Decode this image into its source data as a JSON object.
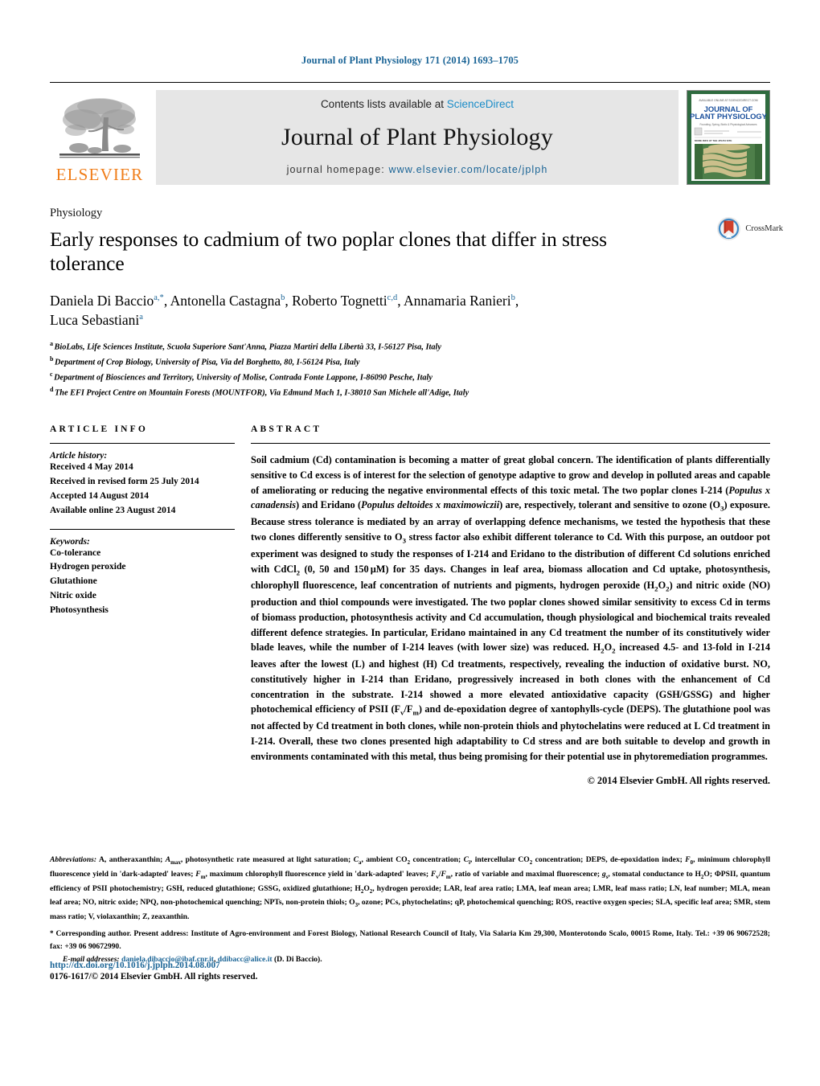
{
  "running_head": "Journal of Plant Physiology 171 (2014) 1693–1705",
  "masthead": {
    "publisher_logo_text": "ELSEVIER",
    "contents_prefix": "Contents lists available at ",
    "contents_link": "ScienceDirect",
    "journal_name": "Journal of Plant Physiology",
    "homepage_prefix": "journal homepage: ",
    "homepage_url": "www.elsevier.com/locate/jplph",
    "cover_title_line1": "JOURNAL OF",
    "cover_title_line2": "PLANT PHYSIOLOGY"
  },
  "article": {
    "section_kicker": "Physiology",
    "title": "Early responses to cadmium of two poplar clones that differ in stress tolerance",
    "crossmark_label": "CrossMark",
    "authors": [
      {
        "name": "Daniela Di Baccio",
        "marks": "a,*"
      },
      {
        "name": "Antonella Castagna",
        "marks": "b"
      },
      {
        "name": "Roberto Tognetti",
        "marks": "c,d"
      },
      {
        "name": "Annamaria Ranieri",
        "marks": "b"
      },
      {
        "name": "Luca Sebastiani",
        "marks": "a"
      }
    ],
    "affiliations": [
      {
        "mark": "a",
        "text": "BioLabs, Life Sciences Institute, Scuola Superiore Sant'Anna, Piazza Martiri della Libertà 33, I-56127 Pisa, Italy"
      },
      {
        "mark": "b",
        "text": "Department of Crop Biology, University of Pisa, Via del Borghetto, 80, I-56124 Pisa, Italy"
      },
      {
        "mark": "c",
        "text": "Department of Biosciences and Territory, University of Molise, Contrada Fonte Lappone, I-86090 Pesche, Italy"
      },
      {
        "mark": "d",
        "text": "The EFI Project Centre on Mountain Forests (MOUNTFOR), Via Edmund Mach 1, I-38010 San Michele all'Adige, Italy"
      }
    ]
  },
  "article_info": {
    "heading": "ARTICLE INFO",
    "history_label": "Article history:",
    "history": [
      "Received 4 May 2014",
      "Received in revised form 25 July 2014",
      "Accepted 14 August 2014",
      "Available online 23 August 2014"
    ],
    "keywords_label": "Keywords:",
    "keywords": [
      "Co-tolerance",
      "Hydrogen peroxide",
      "Glutathione",
      "Nitric oxide",
      "Photosynthesis"
    ]
  },
  "abstract": {
    "heading": "ABSTRACT",
    "copyright": "© 2014 Elsevier GmbH. All rights reserved."
  },
  "footnotes": {
    "abbreviations_label": "Abbreviations:",
    "corresponding_marker": "*",
    "corresponding_text": "Corresponding author. Present address: Institute of Agro-environment and Forest Biology, National Research Council of Italy, Via Salaria Km 29,300, Monterotondo Scalo, 00015 Rome, Italy. Tel.: +39 06 90672528; fax: +39 06 90672990.",
    "emails_label": "E-mail addresses:",
    "email_1": "daniela.dibaccio@ibaf.cnr.it",
    "email_2": "ddibacc@alice.it",
    "emails_suffix": "(D. Di Baccio)."
  },
  "doi": {
    "url": "http://dx.doi.org/10.1016/j.jplph.2014.08.007",
    "issn_line": "0176-1617/© 2014 Elsevier GmbH. All rights reserved."
  },
  "colors": {
    "link_blue": "#1a6496",
    "sciencedirect_blue": "#1a8cc8",
    "elsevier_orange": "#f07d19",
    "band_grey": "#e6e6e6"
  }
}
